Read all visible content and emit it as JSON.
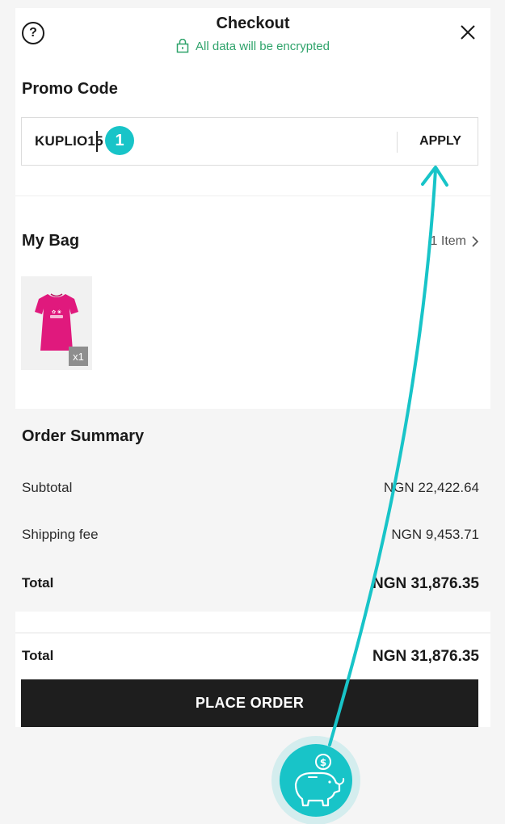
{
  "header": {
    "title": "Checkout",
    "subtitle": "All data will be encrypted"
  },
  "promo": {
    "title": "Promo Code",
    "value": "KUPLIO15",
    "badge": "1",
    "apply_label": "APPLY"
  },
  "bag": {
    "title": "My Bag",
    "item_count_label": "1 Item",
    "quantity_label": "x1"
  },
  "summary": {
    "title": "Order Summary",
    "rows": [
      {
        "label": "Subtotal",
        "value": "NGN 22,422.64"
      },
      {
        "label": "Shipping fee",
        "value": "NGN 9,453.71"
      },
      {
        "label": "Total",
        "value": "NGN 31,876.35"
      }
    ]
  },
  "footer": {
    "total_label": "Total",
    "total_value": "NGN 31,876.35",
    "place_order_label": "PLACE ORDER"
  },
  "colors": {
    "accent": "#18c4c8",
    "encrypted_green": "#2fa36b",
    "product_pink": "#e0197d",
    "button_dark": "#1e1e1e"
  },
  "icons": [
    "help-icon",
    "close-icon",
    "lock-icon",
    "chevron-right-icon",
    "piggy-bank-icon",
    "dollar-coin-icon"
  ]
}
